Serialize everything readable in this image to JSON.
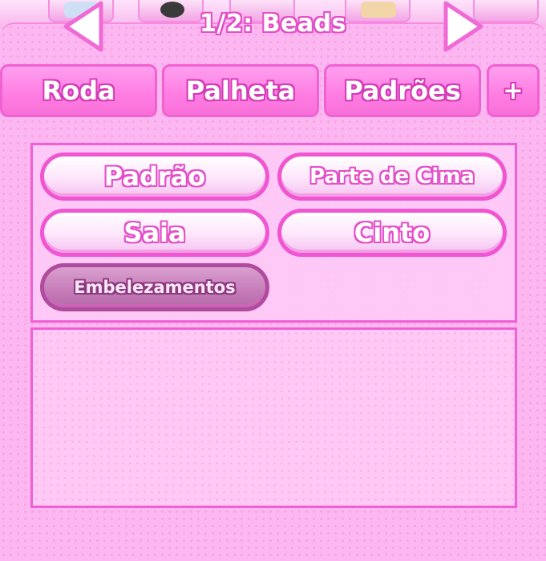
{
  "header": {
    "title": "1/2: Beads",
    "prev_icon": "chevron-left-icon",
    "next_icon": "chevron-right-icon"
  },
  "tabs": [
    {
      "label": "Roda"
    },
    {
      "label": "Palheta"
    },
    {
      "label": "Padrões"
    },
    {
      "label": "+"
    }
  ],
  "categories": [
    {
      "label": "Padrão",
      "selected": false
    },
    {
      "label": "Parte de Cima",
      "selected": false
    },
    {
      "label": "Saia",
      "selected": false
    },
    {
      "label": "Cinto",
      "selected": false
    },
    {
      "label": "Embelezamentos",
      "selected": true
    }
  ],
  "colors": {
    "accent": "#f055d2",
    "panel": "#fcb7f0",
    "tab": "#ff7fe3",
    "selected": "#c77eba"
  }
}
